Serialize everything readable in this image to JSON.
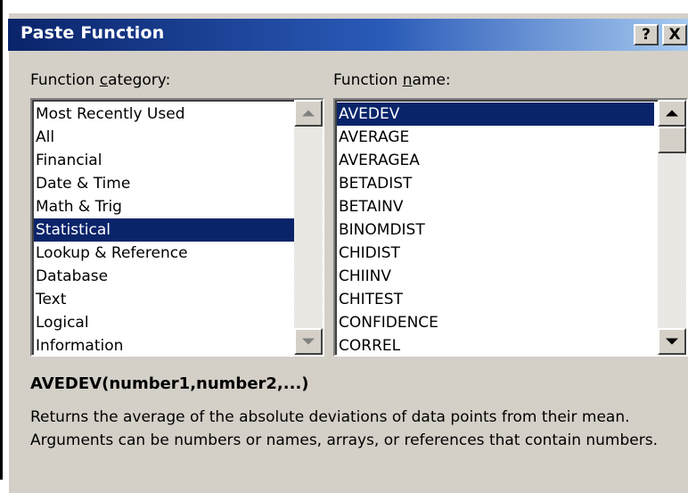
{
  "dialog": {
    "title": "Paste Function",
    "help_button": "?",
    "close_button": "X"
  },
  "category": {
    "label_pre": "Function ",
    "label_accel": "c",
    "label_post": "ategory:",
    "items": [
      "Most Recently Used",
      "All",
      "Financial",
      "Date & Time",
      "Math & Trig",
      "Statistical",
      "Lookup & Reference",
      "Database",
      "Text",
      "Logical",
      "Information"
    ],
    "selected": "Statistical"
  },
  "function": {
    "label_pre": "Function ",
    "label_accel": "n",
    "label_post": "ame:",
    "items": [
      "AVEDEV",
      "AVERAGE",
      "AVERAGEA",
      "BETADIST",
      "BETAINV",
      "BINOMDIST",
      "CHIDIST",
      "CHIINV",
      "CHITEST",
      "CONFIDENCE",
      "CORREL"
    ],
    "selected": "AVEDEV"
  },
  "signature": "AVEDEV(number1,number2,...)",
  "description": "Returns the average of the absolute deviations of data points from their mean. Arguments can be numbers or names, arrays, or references that contain numbers."
}
